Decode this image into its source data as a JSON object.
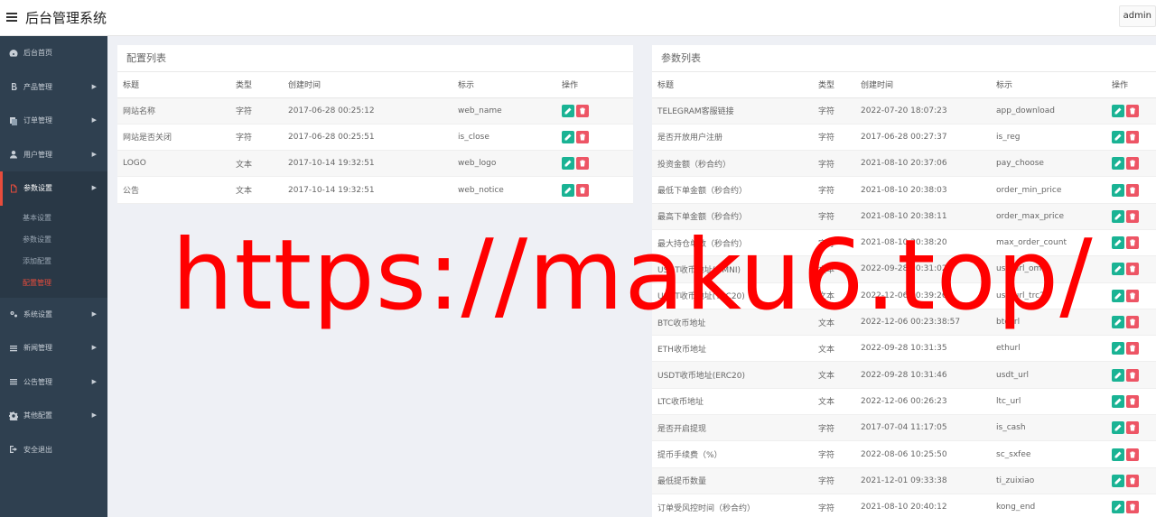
{
  "app": {
    "title": "后台管理系统",
    "user": "admin"
  },
  "sidebar": {
    "items": [
      {
        "label": "后台首页",
        "icon": "dashboard-icon"
      },
      {
        "label": "产品管理",
        "icon": "bitcoin-icon",
        "has_children": true
      },
      {
        "label": "订单管理",
        "icon": "orders-icon",
        "has_children": true
      },
      {
        "label": "用户管理",
        "icon": "user-icon",
        "has_children": true
      },
      {
        "label": "参数设置",
        "icon": "file-icon",
        "has_children": true,
        "active": true
      },
      {
        "label": "系统设置",
        "icon": "gears-icon",
        "has_children": true
      },
      {
        "label": "新闻管理",
        "icon": "list-icon",
        "has_children": true
      },
      {
        "label": "公告管理",
        "icon": "list-icon",
        "has_children": true
      },
      {
        "label": "其他配置",
        "icon": "gear-icon",
        "has_children": true
      },
      {
        "label": "安全退出",
        "icon": "sign-out-icon"
      }
    ],
    "submenu": [
      {
        "label": "基本设置"
      },
      {
        "label": "参数设置"
      },
      {
        "label": "添加配置"
      },
      {
        "label": "配置管理",
        "active": true
      }
    ]
  },
  "config_panel": {
    "title": "配置列表",
    "columns": [
      "标题",
      "类型",
      "创建时间",
      "标示",
      "操作"
    ],
    "rows": [
      [
        "网站名称",
        "字符",
        "2017-06-28 00:25:12",
        "web_name"
      ],
      [
        "网站是否关闭",
        "字符",
        "2017-06-28 00:25:51",
        "is_close"
      ],
      [
        "LOGO",
        "文本",
        "2017-10-14 19:32:51",
        "web_logo"
      ],
      [
        "公告",
        "文本",
        "2017-10-14 19:32:51",
        "web_notice"
      ]
    ]
  },
  "param_panel": {
    "title": "参数列表",
    "columns": [
      "标题",
      "类型",
      "创建时间",
      "标示",
      "操作"
    ],
    "rows": [
      [
        "TELEGRAM客服链接",
        "字符",
        "2022-07-20 18:07:23",
        "app_download"
      ],
      [
        "是否开放用户注册",
        "字符",
        "2017-06-28 00:27:37",
        "is_reg"
      ],
      [
        "投资金额（秒合约）",
        "字符",
        "2021-08-10 20:37:06",
        "pay_choose"
      ],
      [
        "最低下单金额（秒合约）",
        "字符",
        "2021-08-10 20:38:03",
        "order_min_price"
      ],
      [
        "最高下单金额（秒合约）",
        "字符",
        "2021-08-10 20:38:11",
        "order_max_price"
      ],
      [
        "最大持仓单数（秒合约）",
        "字符",
        "2021-08-10 20:38:20",
        "max_order_count"
      ],
      [
        "USDT收币地址(OMNI)",
        "文本",
        "2022-09-28 10:31:02",
        "usdturl_omni"
      ],
      [
        "USDT收币地址(TRC20)",
        "文本",
        "2022-12-06 00:39:26",
        "usdturl_trc20"
      ],
      [
        "BTC收币地址",
        "文本",
        "2022-12-06 00:23:38:57",
        "btcurl"
      ],
      [
        "ETH收币地址",
        "文本",
        "2022-09-28 10:31:35",
        "ethurl"
      ],
      [
        "USDT收币地址(ERC20)",
        "文本",
        "2022-09-28 10:31:46",
        "usdt_url"
      ],
      [
        "LTC收币地址",
        "文本",
        "2022-12-06 00:26:23",
        "ltc_url"
      ],
      [
        "是否开启提现",
        "字符",
        "2017-07-04 11:17:05",
        "is_cash"
      ],
      [
        "提币手续费（%）",
        "字符",
        "2022-08-06 10:25:50",
        "sc_sxfee"
      ],
      [
        "最低提币数量",
        "字符",
        "2021-12-01 09:33:38",
        "ti_zuixiao"
      ],
      [
        "订单受风控时间（秒合约）",
        "字符",
        "2021-08-10 20:40:12",
        "kong_end"
      ]
    ]
  },
  "watermark": "https://maku6.top/"
}
